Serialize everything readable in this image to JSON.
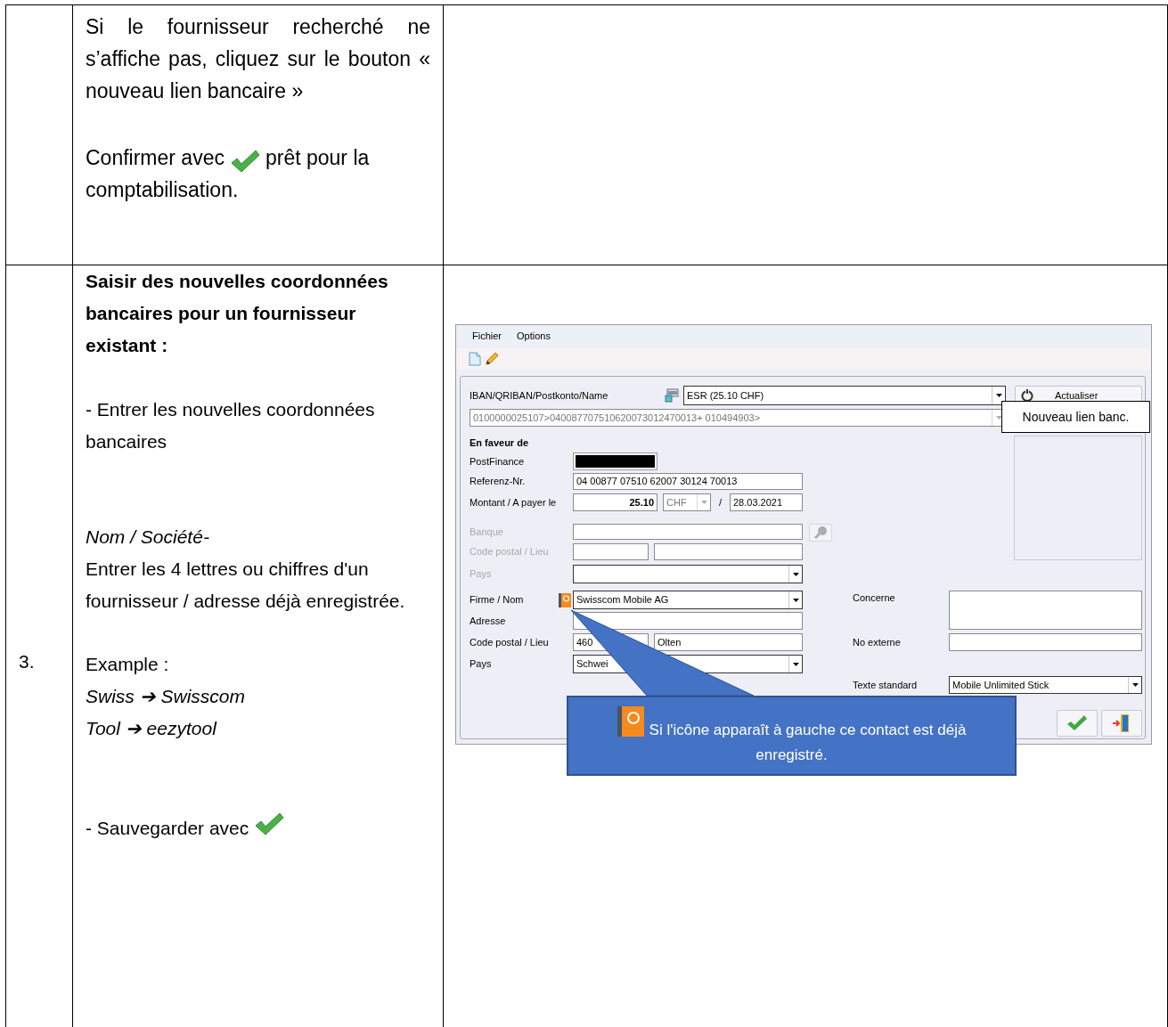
{
  "step_row_1": {
    "paragraph": "Si le fournisseur recherché ne s’affiche pas, cliquez sur le bouton « nouveau lien bancaire »",
    "confirm_before": "Confirmer avec",
    "confirm_after": "prêt pour la",
    "confirm_end": "comptabilisation."
  },
  "step_row_2": {
    "number": "3.",
    "heading": "Saisir des nouvelles coordonnées bancaires pour un fournisseur existant :",
    "intro": "- Entrer les nouvelles coordonnées bancaires",
    "field_label": "Nom / Société-",
    "field_hint": "Entrer les 4 lettres ou chiffres d'un fournisseur / adresse déjà enregistrée.",
    "example_label": "Example :",
    "examples": [
      "Swiss ➔ Swisscom",
      "Tool ➔ eezytool"
    ],
    "save_text": "- Sauvegarder avec"
  },
  "app_window": {
    "menu": [
      "Fichier",
      "Options"
    ],
    "account_label": "IBAN/QRIBAN/Postkonto/Name",
    "account_value": "ESR (25.10 CHF)",
    "refresh_button": "Actualiser",
    "code_line": "0100000025107>040087707510620073012470013+ 010494903>",
    "tooltip": "Nouveau lien banc.",
    "section_title": "En faveur de",
    "postfinance_label": "PostFinance",
    "reference_label": "Referenz-Nr.",
    "reference_value": "04 00877 07510 62007 30124 70013",
    "amount_label": "Montant / A payer le",
    "amount": "25.10",
    "currency": "CHF",
    "separator": "/",
    "due_date": "28.03.2021",
    "bank": {
      "disabled": true,
      "bank_label": "Banque",
      "postal_label": "Code postal / Lieu",
      "country_label": "Pays"
    },
    "supplier": {
      "name_label": "Firme / Nom",
      "name": "Swisscom Mobile AG",
      "address_label": "Adresse",
      "postal_label": "Code postal / Lieu",
      "postal_code": "460",
      "city": "Olten",
      "country_label": "Pays",
      "country": "Schwei"
    },
    "concerne_label": "Concerne",
    "external_label": "No externe",
    "standard_text_label": "Texte standard",
    "standard_text": "Mobile Unlimited Stick",
    "callout": "Si l'icône apparaît à gauche ce contact est déjà enregistré."
  }
}
